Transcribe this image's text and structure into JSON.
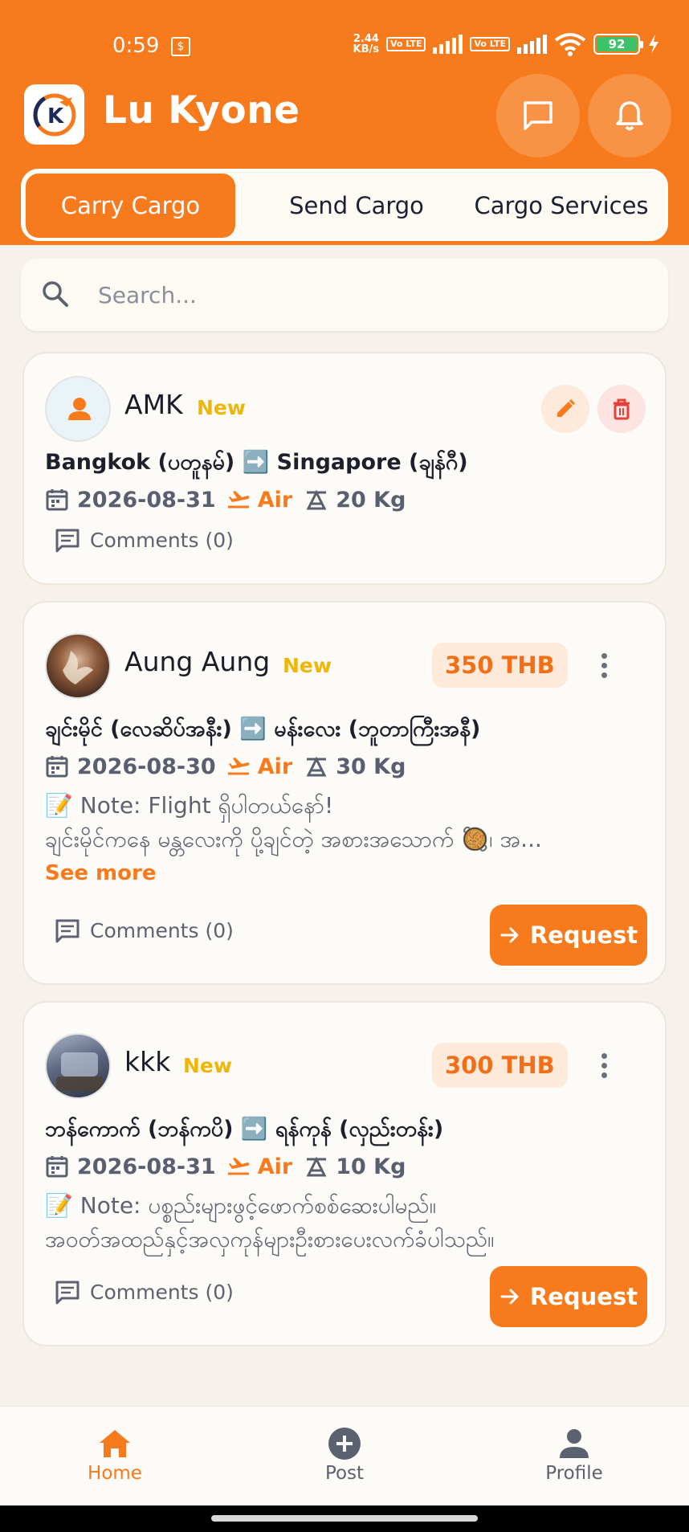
{
  "status_bar": {
    "time": "0:59",
    "net_speed_value": "2.44",
    "net_speed_unit": "KB/s",
    "volte_1": "Vo LTE",
    "volte_2": "Vo LTE",
    "battery": "92"
  },
  "header": {
    "title": "Lu Kyone",
    "colors": {
      "brand": "#f77a1c",
      "badge_new": "#efb60a"
    }
  },
  "tabs": [
    {
      "label": "Carry Cargo",
      "active": true
    },
    {
      "label": "Send Cargo",
      "active": false
    },
    {
      "label": "Cargo Services",
      "active": false
    }
  ],
  "search": {
    "placeholder": "Search...",
    "value": ""
  },
  "posts": [
    {
      "user": "AMK",
      "badge": "New",
      "route": "Bangkok (ပတူနမ်) ➡️ Singapore (ချန်ဂီ)",
      "date": "2026-08-31",
      "mode": "Air",
      "weight": "20 Kg",
      "comments": "Comments (0)"
    },
    {
      "user": "Aung Aung",
      "badge": "New",
      "price": "350 THB",
      "route": "ချင်းမိုင် (လေဆိပ်အနီး) ➡️ မန်းလေး (ဘူတာကြီးအနီ)",
      "date": "2026-08-30",
      "mode": "Air",
      "weight": "30 Kg",
      "note_line1": "📝 Note: Flight ရှိပါတယ်နော်!",
      "note_line2": "ချင်းမိုင်ကနေ မန္တလေးကို ပို့ချင်တဲ့ အစားအသောက် 🥘၊ အ...",
      "see_more": "See more",
      "comments": "Comments (0)",
      "request": "Request"
    },
    {
      "user": "kkk",
      "badge": "New",
      "price": "300 THB",
      "route": "ဘန်ကောက် (ဘန်ကပိ) ➡️ ရန်ကုန် (လှည်းတန်း)",
      "date": "2026-08-31",
      "mode": "Air",
      "weight": "10 Kg",
      "note_line1": "📝 Note: ပစ္စည်းများဖွင့်ဖောက်စစ်ဆေးပါမည်။",
      "note_line2": "အဝတ်အထည်နှင့်အလှကုန်များဦးစားပေးလက်ခံပါသည်။",
      "comments": "Comments (0)",
      "request": "Request"
    }
  ],
  "bottom_nav": [
    {
      "label": "Home",
      "icon": "home-icon",
      "active": true
    },
    {
      "label": "Post",
      "icon": "plus-circle-icon",
      "active": false
    },
    {
      "label": "Profile",
      "icon": "person-icon",
      "active": false
    }
  ]
}
